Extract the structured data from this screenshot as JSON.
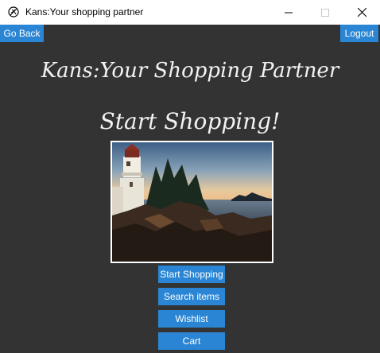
{
  "window": {
    "title": "Kans:Your shopping partner"
  },
  "nav": {
    "go_back": "Go Back",
    "logout": "Logout"
  },
  "main": {
    "app_heading": "Kans:Your Shopping Partner",
    "start_heading": "Start Shopping!",
    "image_subject": "lighthouse-at-sunset"
  },
  "menu": {
    "start_shopping": "Start Shopping",
    "search_items": "Search items",
    "wishlist": "Wishlist",
    "cart": "Cart"
  },
  "colors": {
    "background": "#333333",
    "button": "#2a86d4",
    "text": "#f2f2f2"
  }
}
